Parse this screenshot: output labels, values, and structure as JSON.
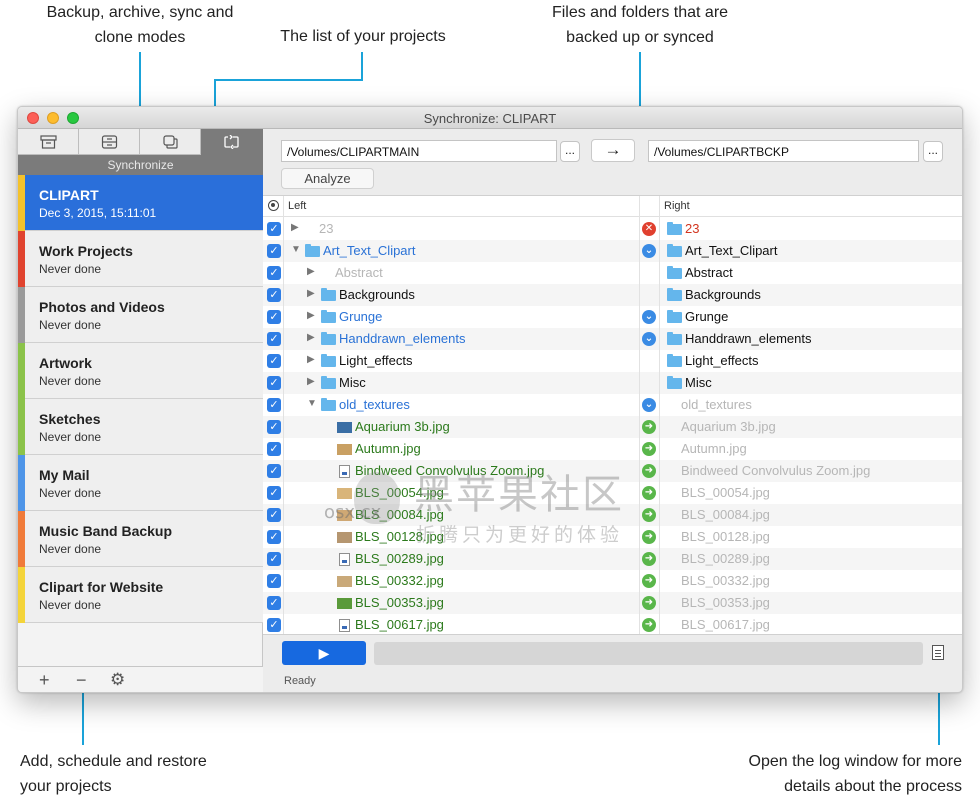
{
  "callouts": {
    "modes": [
      "Backup, archive, sync and",
      "clone modes"
    ],
    "projects_list": "The list of your projects",
    "files": [
      "Files and folders that are",
      "backed up or synced"
    ],
    "add": [
      "Add, schedule and restore",
      "your projects"
    ],
    "log": [
      "Open the log window for more",
      "details about the process"
    ]
  },
  "window": {
    "title": "Synchronize: CLIPART"
  },
  "sidebar": {
    "mode_label": "Synchronize",
    "modes": [
      "archive-box-icon",
      "backup-drive-icon",
      "clone-icon",
      "sync-icon"
    ],
    "projects": [
      {
        "name": "CLIPART",
        "date": "Dec 3, 2015, 15:11:01",
        "color": "#f4c22b",
        "selected": true
      },
      {
        "name": "Work Projects",
        "date": "Never done",
        "color": "#e0432f"
      },
      {
        "name": "Photos and Videos",
        "date": "Never done",
        "color": "#9a9a9a"
      },
      {
        "name": "Artwork",
        "date": "Never done",
        "color": "#8bc34a"
      },
      {
        "name": "Sketches",
        "date": "Never done",
        "color": "#8bc34a"
      },
      {
        "name": "My Mail",
        "date": "Never done",
        "color": "#4e95e8"
      },
      {
        "name": "Music Band Backup",
        "date": "Never done",
        "color": "#f07b3a"
      },
      {
        "name": "Clipart for Website",
        "date": "Never done",
        "color": "#f4d43a"
      }
    ],
    "bottom": {
      "add": "+",
      "remove": "−",
      "settings": "⚙"
    }
  },
  "paths": {
    "left": "/Volumes/CLIPARTMAIN",
    "right": "/Volumes/CLIPARTBCKP",
    "browse": "...",
    "direction": "→",
    "analyze": "Analyze"
  },
  "table": {
    "header_left": "Left",
    "header_right": "Right",
    "rows": [
      {
        "indent": 0,
        "tri": "▶",
        "kind": "none",
        "left": "23",
        "lcolor": "gray",
        "action": "red",
        "right": "23",
        "rcolor": "red",
        "rfolder": true
      },
      {
        "indent": 0,
        "tri": "▼",
        "kind": "folder",
        "left": "Art_Text_Clipart",
        "lcolor": "blue",
        "action": "blue",
        "right": "Art_Text_Clipart",
        "rcolor": "black",
        "rfolder": true
      },
      {
        "indent": 1,
        "tri": "▶",
        "kind": "none",
        "left": "Abstract",
        "lcolor": "gray",
        "action": "",
        "right": "Abstract",
        "rcolor": "black",
        "rfolder": true
      },
      {
        "indent": 1,
        "tri": "▶",
        "kind": "folder",
        "left": "Backgrounds",
        "lcolor": "black",
        "action": "",
        "right": "Backgrounds",
        "rcolor": "black",
        "rfolder": true
      },
      {
        "indent": 1,
        "tri": "▶",
        "kind": "folder",
        "left": "Grunge",
        "lcolor": "blue",
        "action": "blue",
        "right": "Grunge",
        "rcolor": "black",
        "rfolder": true
      },
      {
        "indent": 1,
        "tri": "▶",
        "kind": "folder",
        "left": "Handdrawn_elements",
        "lcolor": "blue",
        "action": "blue",
        "right": "Handdrawn_elements",
        "rcolor": "black",
        "rfolder": true
      },
      {
        "indent": 1,
        "tri": "▶",
        "kind": "folder",
        "left": "Light_effects",
        "lcolor": "black",
        "action": "",
        "right": "Light_effects",
        "rcolor": "black",
        "rfolder": true
      },
      {
        "indent": 1,
        "tri": "▶",
        "kind": "folder",
        "left": "Misc",
        "lcolor": "black",
        "action": "",
        "right": "Misc",
        "rcolor": "black",
        "rfolder": true
      },
      {
        "indent": 1,
        "tri": "▼",
        "kind": "folder",
        "left": "old_textures",
        "lcolor": "blue",
        "action": "blue",
        "right": "old_textures",
        "rcolor": "gray",
        "rfolder": false
      },
      {
        "indent": 2,
        "tri": "",
        "kind": "thumb",
        "thumb": "#3a6ea5",
        "left": "Aquarium 3b.jpg",
        "lcolor": "green",
        "action": "green",
        "right": "Aquarium 3b.jpg",
        "rcolor": "gray",
        "rfolder": false
      },
      {
        "indent": 2,
        "tri": "",
        "kind": "thumb",
        "thumb": "#c9a063",
        "left": "Autumn.jpg",
        "lcolor": "green",
        "action": "green",
        "right": "Autumn.jpg",
        "rcolor": "gray",
        "rfolder": false
      },
      {
        "indent": 2,
        "tri": "",
        "kind": "file",
        "left": "Bindweed Convolvulus Zoom.jpg",
        "lcolor": "green",
        "action": "green",
        "right": "Bindweed Convolvulus Zoom.jpg",
        "rcolor": "gray",
        "rfolder": false
      },
      {
        "indent": 2,
        "tri": "",
        "kind": "thumb",
        "thumb": "#d9b57a",
        "left": "BLS_00054.jpg",
        "lcolor": "green",
        "action": "green",
        "right": "BLS_00054.jpg",
        "rcolor": "gray",
        "rfolder": false
      },
      {
        "indent": 2,
        "tri": "",
        "kind": "thumb",
        "thumb": "#cfa874",
        "left": "BLS_00084.jpg",
        "lcolor": "green",
        "action": "green",
        "right": "BLS_00084.jpg",
        "rcolor": "gray",
        "rfolder": false
      },
      {
        "indent": 2,
        "tri": "",
        "kind": "thumb",
        "thumb": "#b59670",
        "left": "BLS_00128.jpg",
        "lcolor": "green",
        "action": "green",
        "right": "BLS_00128.jpg",
        "rcolor": "gray",
        "rfolder": false
      },
      {
        "indent": 2,
        "tri": "",
        "kind": "file",
        "left": "BLS_00289.jpg",
        "lcolor": "green",
        "action": "green",
        "right": "BLS_00289.jpg",
        "rcolor": "gray",
        "rfolder": false
      },
      {
        "indent": 2,
        "tri": "",
        "kind": "thumb",
        "thumb": "#c9a979",
        "left": "BLS_00332.jpg",
        "lcolor": "green",
        "action": "green",
        "right": "BLS_00332.jpg",
        "rcolor": "gray",
        "rfolder": false
      },
      {
        "indent": 2,
        "tri": "",
        "kind": "thumb",
        "thumb": "#5a9a3a",
        "left": "BLS_00353.jpg",
        "lcolor": "green",
        "action": "green",
        "right": "BLS_00353.jpg",
        "rcolor": "gray",
        "rfolder": false
      },
      {
        "indent": 2,
        "tri": "",
        "kind": "file",
        "left": "BLS_00617.jpg",
        "lcolor": "green",
        "action": "green",
        "right": "BLS_00617.jpg",
        "rcolor": "gray",
        "rfolder": false
      }
    ]
  },
  "footer": {
    "play": "▶",
    "status": "Ready",
    "log_icon": "log-document-icon",
    "progress": 0
  },
  "watermark": {
    "big": "黑苹果社区",
    "small": "折腾只为更好的体验",
    "site": "osx.cx"
  }
}
